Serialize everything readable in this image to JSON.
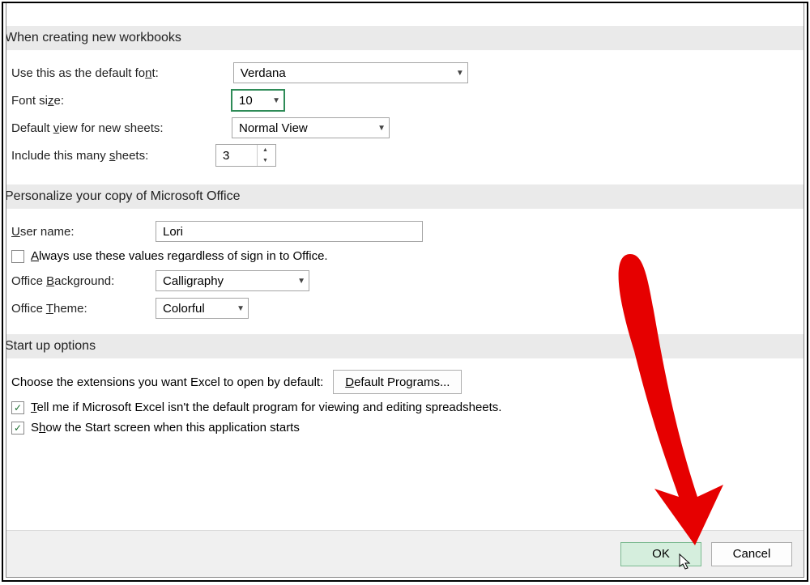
{
  "sections": {
    "workbooks": "When creating new workbooks",
    "personalize": "Personalize your copy of Microsoft Office",
    "startup": "Start up options"
  },
  "workbooks": {
    "font_label": "Use this as the default font:",
    "font_value": "Verdana",
    "size_label": "Font size:",
    "size_value": "10",
    "view_label": "Default view for new sheets:",
    "view_value": "Normal View",
    "sheets_label": "Include this many sheets:",
    "sheets_value": "3"
  },
  "personalize": {
    "user_label": "User name:",
    "user_value": "Lori",
    "always_label": "Always use these values regardless of sign in to Office.",
    "always_checked": false,
    "background_label": "Office Background:",
    "background_value": "Calligraphy",
    "theme_label": "Office Theme:",
    "theme_value": "Colorful"
  },
  "startup": {
    "choose_label": "Choose the extensions you want Excel to open by default:",
    "programs_btn": "Default Programs...",
    "tell_label": "Tell me if Microsoft Excel isn't the default program for viewing and editing spreadsheets.",
    "tell_checked": true,
    "show_label": "Show the Start screen when this application starts",
    "show_checked": true
  },
  "buttons": {
    "ok": "OK",
    "cancel": "Cancel"
  }
}
